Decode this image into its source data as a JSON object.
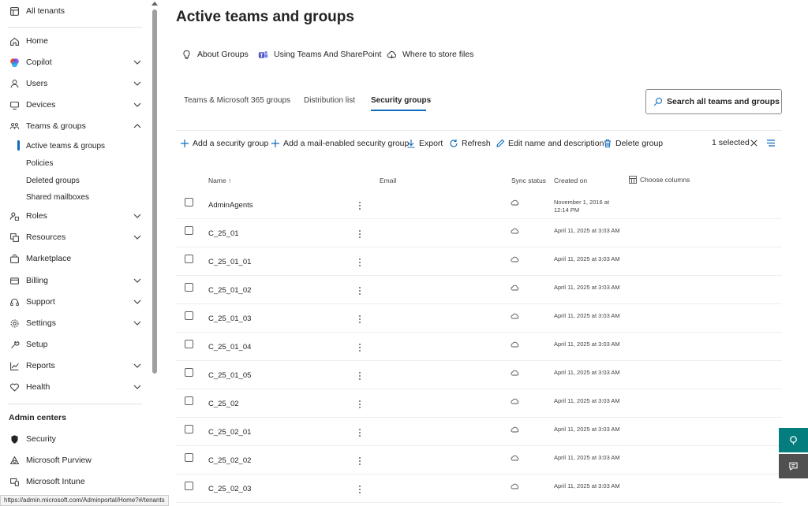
{
  "sidebar": {
    "tenants_label": "All tenants",
    "items": [
      {
        "label": "Home",
        "icon": "home-icon",
        "chevron": "none"
      },
      {
        "label": "Copilot",
        "icon": "copilot-icon",
        "chevron": "down"
      },
      {
        "label": "Users",
        "icon": "user-icon",
        "chevron": "down"
      },
      {
        "label": "Devices",
        "icon": "devices-icon",
        "chevron": "down"
      },
      {
        "label": "Teams & groups",
        "icon": "people-team-icon",
        "chevron": "up"
      },
      {
        "label": "Roles",
        "icon": "roles-icon",
        "chevron": "down"
      },
      {
        "label": "Resources",
        "icon": "resources-icon",
        "chevron": "down"
      },
      {
        "label": "Marketplace",
        "icon": "shopping-bag-icon",
        "chevron": "none"
      },
      {
        "label": "Billing",
        "icon": "billing-icon",
        "chevron": "down"
      },
      {
        "label": "Support",
        "icon": "headset-icon",
        "chevron": "down"
      },
      {
        "label": "Settings",
        "icon": "gear-icon",
        "chevron": "down"
      },
      {
        "label": "Setup",
        "icon": "wrench-icon",
        "chevron": "none"
      },
      {
        "label": "Reports",
        "icon": "chart-line-icon",
        "chevron": "down"
      },
      {
        "label": "Health",
        "icon": "heart-icon",
        "chevron": "down"
      }
    ],
    "subitems": [
      {
        "label": "Active teams & groups",
        "active": true
      },
      {
        "label": "Policies",
        "active": false
      },
      {
        "label": "Deleted groups",
        "active": false
      },
      {
        "label": "Shared mailboxes",
        "active": false
      }
    ],
    "admin_centers_heading": "Admin centers",
    "admin_centers": [
      {
        "label": "Security",
        "icon": "shield-icon"
      },
      {
        "label": "Microsoft Purview",
        "icon": "purview-icon"
      },
      {
        "label": "Microsoft Intune",
        "icon": "intune-icon"
      }
    ]
  },
  "main": {
    "title": "Active teams and groups",
    "learn_links": [
      {
        "label": "About Groups",
        "icon": "lightbulb-icon"
      },
      {
        "label": "Using Teams And SharePoint",
        "icon": "teams-icon"
      },
      {
        "label": "Where to store files",
        "icon": "cloud-icon"
      }
    ],
    "tabs": [
      {
        "label": "Teams & Microsoft 365 groups",
        "active": false
      },
      {
        "label": "Distribution list",
        "active": false
      },
      {
        "label": "Security groups",
        "active": true
      }
    ],
    "search_placeholder": "Search all teams and groups",
    "toolbar": {
      "add_security": "Add a security group",
      "add_mail_security": "Add a mail-enabled security group",
      "export": "Export",
      "refresh": "Refresh",
      "edit": "Edit name and description",
      "delete": "Delete group",
      "selected_count": "1 selected"
    },
    "table": {
      "headers": {
        "name": "Name ↑",
        "email": "Email",
        "sync": "Sync status",
        "created": "Created on",
        "choose_columns": "Choose columns"
      },
      "rows": [
        {
          "name": "AdminAgents",
          "created": "November 1, 2016 at 12:14 PM",
          "selected": true
        },
        {
          "name": "C_25_01",
          "created": "April 11, 2025 at 3:03 AM",
          "selected": false
        },
        {
          "name": "C_25_01_01",
          "created": "April 11, 2025 at 3:03 AM",
          "selected": false
        },
        {
          "name": "C_25_01_02",
          "created": "April 11, 2025 at 3:03 AM",
          "selected": false
        },
        {
          "name": "C_25_01_03",
          "created": "April 11, 2025 at 3:03 AM",
          "selected": false
        },
        {
          "name": "C_25_01_04",
          "created": "April 11, 2025 at 3:03 AM",
          "selected": false
        },
        {
          "name": "C_25_01_05",
          "created": "April 11, 2025 at 3:03 AM",
          "selected": false
        },
        {
          "name": "C_25_02",
          "created": "April 11, 2025 at 3:03 AM",
          "selected": false
        },
        {
          "name": "C_25_02_01",
          "created": "April 11, 2025 at 3:03 AM",
          "selected": false
        },
        {
          "name": "C_25_02_02",
          "created": "April 11, 2025 at 3:03 AM",
          "selected": false
        },
        {
          "name": "C_25_02_03",
          "created": "April 11, 2025 at 3:03 AM",
          "selected": false
        }
      ]
    }
  },
  "status_url": "https://admin.microsoft.com/Adminportal/Home?#/tenants",
  "colors": {
    "accent": "#0f6cbd",
    "copilot_fab": "#037d7d",
    "feedback_fab": "#505050",
    "selected_row": "#e6e6e6"
  }
}
